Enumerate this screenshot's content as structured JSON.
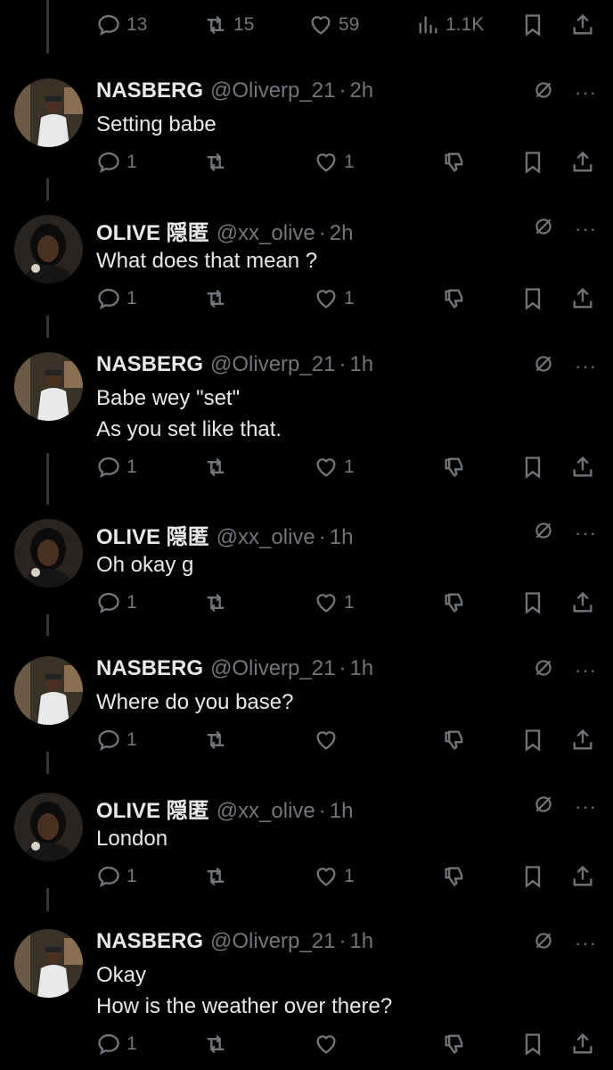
{
  "top_bar": {
    "replies": "13",
    "reposts": "15",
    "likes": "59",
    "views": "1.1K"
  },
  "tweets": [
    {
      "name": "NASBERG",
      "handle": "@Oliverp_21",
      "time": "2h",
      "lines": [
        "Setting babe"
      ],
      "replies": "1",
      "reposts": "",
      "likes": "1"
    },
    {
      "name": "OLIVE 隠匿",
      "handle": "@xx_olive",
      "time": "2h",
      "lines": [
        "What does that mean ?"
      ],
      "replies": "1",
      "reposts": "",
      "likes": "1"
    },
    {
      "name": "NASBERG",
      "handle": "@Oliverp_21",
      "time": "1h",
      "lines": [
        "Babe wey \"set\"",
        "As you set like that."
      ],
      "replies": "1",
      "reposts": "",
      "likes": "1"
    },
    {
      "name": "OLIVE 隠匿",
      "handle": "@xx_olive",
      "time": "1h",
      "lines": [
        "Oh okay g"
      ],
      "replies": "1",
      "reposts": "",
      "likes": "1"
    },
    {
      "name": "NASBERG",
      "handle": "@Oliverp_21",
      "time": "1h",
      "lines": [
        "Where do you base?"
      ],
      "replies": "1",
      "reposts": "",
      "likes": ""
    },
    {
      "name": "OLIVE 隠匿",
      "handle": "@xx_olive",
      "time": "1h",
      "lines": [
        "London"
      ],
      "replies": "1",
      "reposts": "",
      "likes": "1"
    },
    {
      "name": "NASBERG",
      "handle": "@Oliverp_21",
      "time": "1h",
      "lines": [
        "Okay",
        "How is the weather over there?"
      ],
      "replies": "1",
      "reposts": "",
      "likes": ""
    }
  ],
  "icons": {
    "reply": "speech-bubble-icon",
    "repost": "repost-arrows-icon",
    "like": "heart-icon",
    "views": "bar-chart-icon",
    "bookmark": "bookmark-icon",
    "share": "share-upload-icon",
    "dislike": "thumbs-down-icon",
    "grok": "grok-slash-circle-icon",
    "more": "more-dots-icon"
  },
  "colors": {
    "background": "#000000",
    "text": "#e7e9ea",
    "muted": "#71767b",
    "line": "#333639"
  }
}
